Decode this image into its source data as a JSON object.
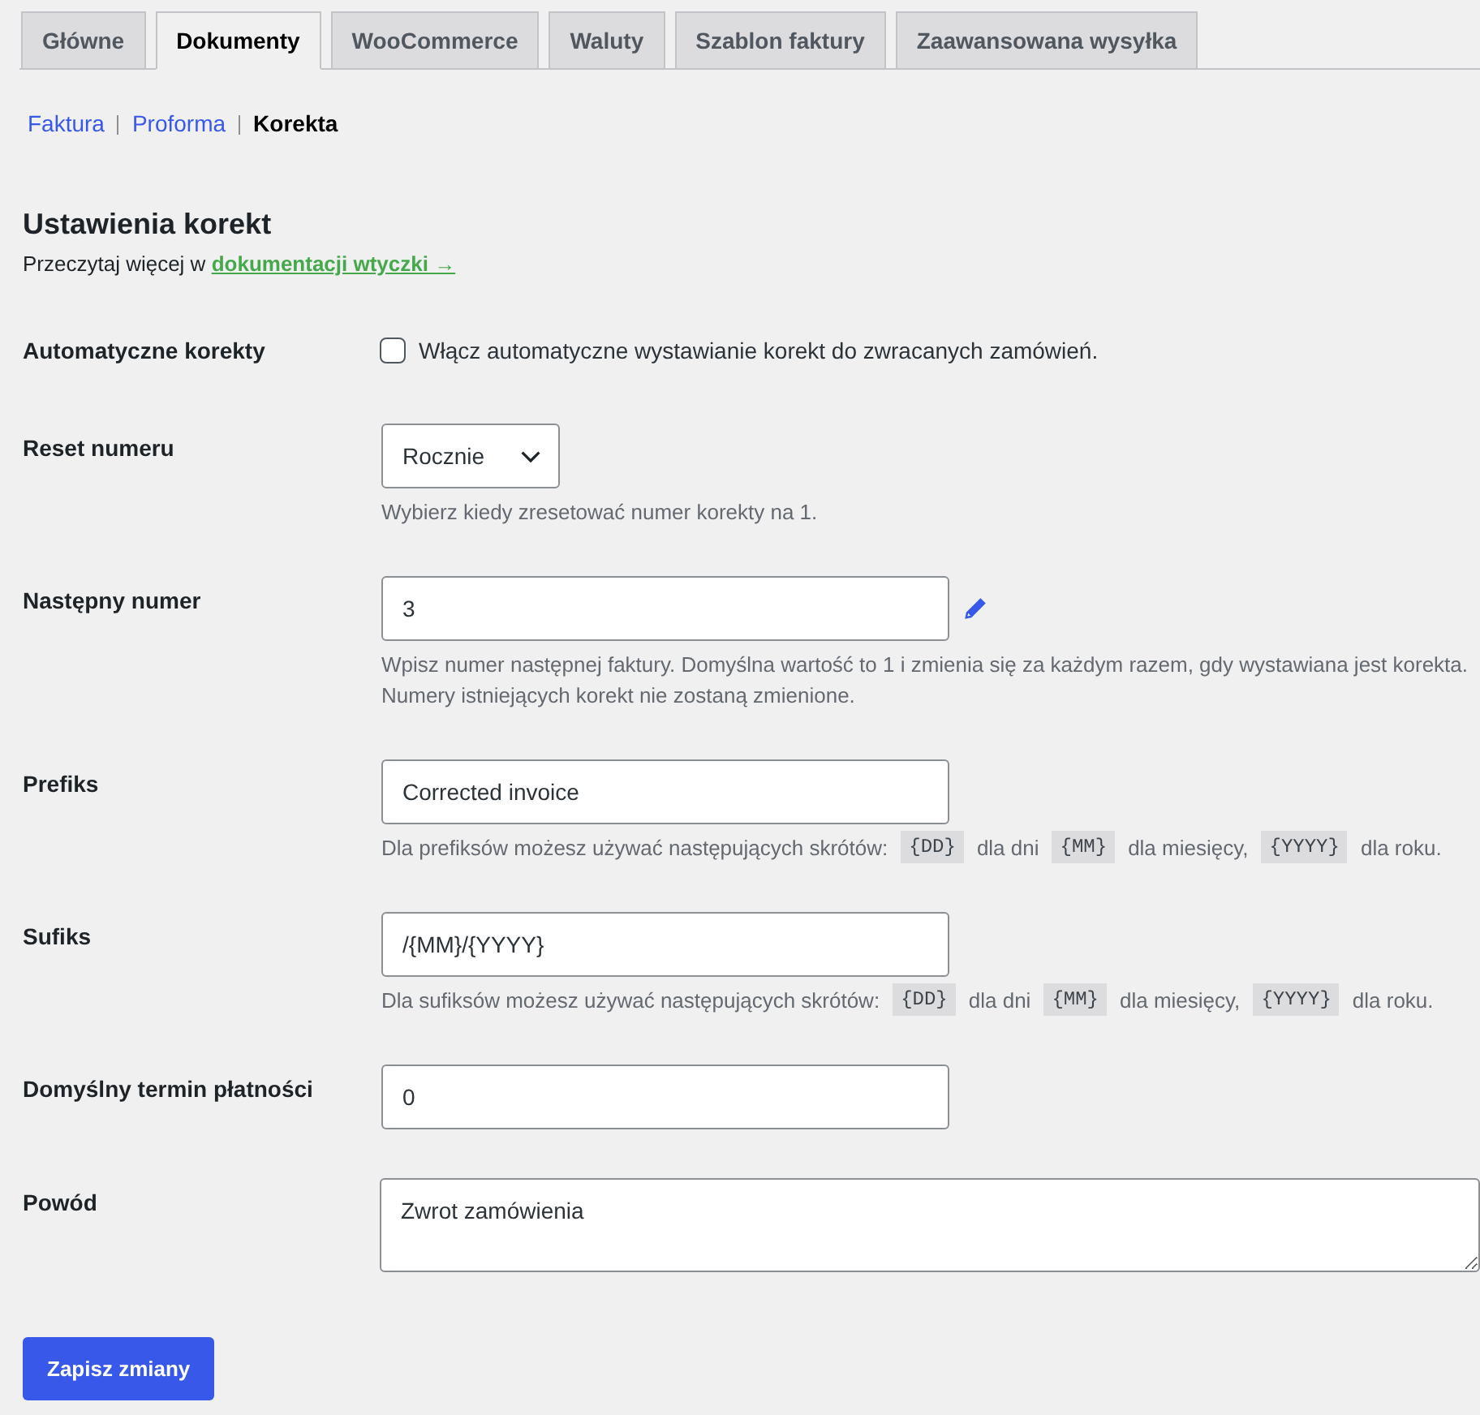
{
  "tabs": [
    {
      "label": "Główne",
      "selected": false
    },
    {
      "label": "Dokumenty",
      "selected": true
    },
    {
      "label": "WooCommerce",
      "selected": false
    },
    {
      "label": "Waluty",
      "selected": false
    },
    {
      "label": "Szablon faktury",
      "selected": false
    },
    {
      "label": "Zaawansowana wysyłka",
      "selected": false
    }
  ],
  "subnav": [
    {
      "label": "Faktura",
      "selected": false
    },
    {
      "label": "Proforma",
      "selected": false
    },
    {
      "label": "Korekta",
      "selected": true
    }
  ],
  "section": {
    "title": "Ustawienia korekt",
    "intro": "Przeczytaj więcej w",
    "link": "dokumentacji wtyczki →"
  },
  "fields": [
    {
      "kind": "checkbox",
      "label": "Automatyczne korekty",
      "checked": false,
      "text": "Włącz automatyczne wystawianie korekt do zwracanych zamówień."
    },
    {
      "kind": "select",
      "label": "Reset numeru",
      "value": "Rocznie",
      "description": [
        {
          "kind": "text",
          "text": "Wybierz kiedy zresetować numer korekty na 1."
        }
      ]
    },
    {
      "kind": "text",
      "label": "Następny numer",
      "value": "3",
      "editable": true,
      "description": [
        {
          "kind": "line",
          "text": "Wpisz numer następnej faktury. Domyślna wartość to 1 i zmienia się za każdym razem, gdy wystawiana jest korekta."
        },
        {
          "kind": "line",
          "text": "Numery istniejących korekt nie zostaną zmienione."
        }
      ]
    },
    {
      "kind": "text",
      "label": "Prefiks",
      "value": "Corrected invoice",
      "description": [
        {
          "kind": "text",
          "text": "Dla prefiksów możesz używać następujących skrótów:"
        },
        {
          "kind": "code",
          "text": "{DD}"
        },
        {
          "kind": "text",
          "text": "dla dni"
        },
        {
          "kind": "code",
          "text": "{MM}"
        },
        {
          "kind": "text",
          "text": "dla miesięcy,"
        },
        {
          "kind": "code",
          "text": "{YYYY}"
        },
        {
          "kind": "text",
          "text": "dla roku."
        }
      ]
    },
    {
      "kind": "text",
      "label": "Sufiks",
      "value": "/{MM}/{YYYY}",
      "description": [
        {
          "kind": "text",
          "text": "Dla sufiksów możesz używać następujących skrótów:"
        },
        {
          "kind": "code",
          "text": "{DD}"
        },
        {
          "kind": "text",
          "text": "dla dni"
        },
        {
          "kind": "code",
          "text": "{MM}"
        },
        {
          "kind": "text",
          "text": "dla miesięcy,"
        },
        {
          "kind": "code",
          "text": "{YYYY}"
        },
        {
          "kind": "text",
          "text": "dla roku."
        }
      ]
    },
    {
      "kind": "text",
      "label": "Domyślny termin płatności",
      "value": "0"
    },
    {
      "kind": "textarea",
      "label": "Powód",
      "value": "Zwrot zamówienia"
    }
  ],
  "save_button": "Zapisz zmiany"
}
